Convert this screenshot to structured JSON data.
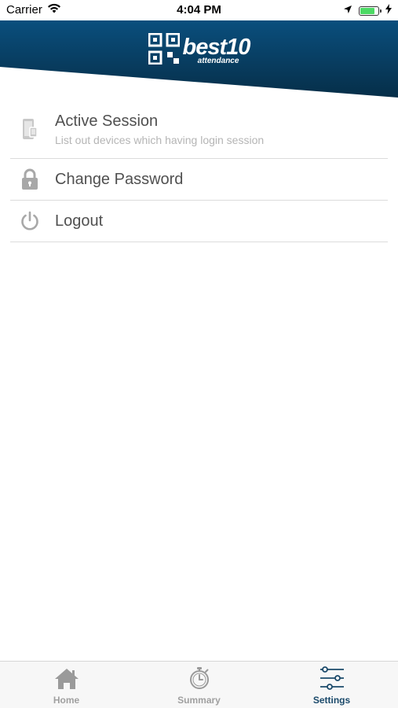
{
  "status_bar": {
    "carrier": "Carrier",
    "time": "4:04 PM"
  },
  "header": {
    "logo_main": "best10",
    "logo_sub": "attendance",
    "gradient_top": "#0a4f7e",
    "gradient_bottom": "#062e48"
  },
  "settings": {
    "items": [
      {
        "title": "Active Session",
        "subtitle": "List out devices which having login session",
        "icon": "device-session-icon"
      },
      {
        "title": "Change Password",
        "icon": "lock-icon"
      },
      {
        "title": "Logout",
        "icon": "power-icon"
      }
    ]
  },
  "tab_bar": {
    "tabs": [
      {
        "label": "Home",
        "icon": "home-icon",
        "active": false
      },
      {
        "label": "Summary",
        "icon": "stopwatch-icon",
        "active": false
      },
      {
        "label": "Settings",
        "icon": "sliders-icon",
        "active": true
      }
    ],
    "active_color": "#1b4a6b",
    "inactive_color": "#a0a0a0"
  }
}
